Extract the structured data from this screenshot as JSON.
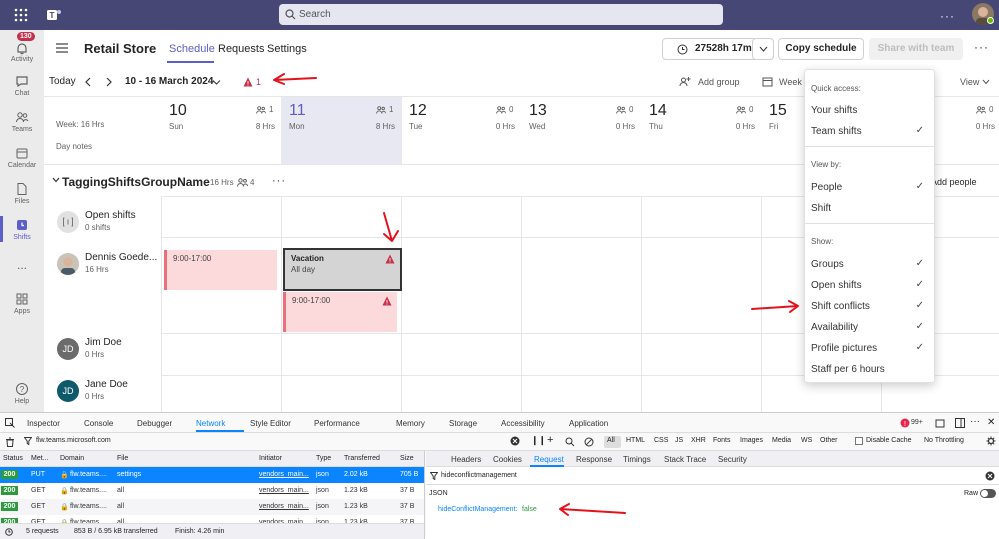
{
  "topbar": {
    "search_placeholder": "Search"
  },
  "rail": {
    "activity_badge": "130",
    "items": [
      {
        "label": "Activity",
        "icon": "bell-icon"
      },
      {
        "label": "Chat",
        "icon": "chat-icon"
      },
      {
        "label": "Teams",
        "icon": "teams-icon"
      },
      {
        "label": "Calendar",
        "icon": "calendar-icon"
      },
      {
        "label": "Files",
        "icon": "files-icon"
      },
      {
        "label": "Shifts",
        "icon": "shifts-icon"
      },
      {
        "label": "...",
        "icon": "more-icon"
      },
      {
        "label": "Apps",
        "icon": "apps-icon"
      },
      {
        "label": "Help",
        "icon": "help-icon"
      }
    ]
  },
  "header": {
    "title": "Retail Store",
    "tabs": [
      "Schedule",
      "Requests",
      "Settings"
    ],
    "timer": "27528h 17m",
    "copy_schedule": "Copy schedule",
    "share": "Share with team"
  },
  "toolbar": {
    "today": "Today",
    "date_range": "10 - 16 March 2024",
    "conflict_count": "1",
    "add_group": "Add group",
    "week": "Week",
    "view": "View"
  },
  "days": [
    {
      "num": "10",
      "name": "Sun",
      "people": "1",
      "hrs": "8 Hrs"
    },
    {
      "num": "11",
      "name": "Mon",
      "people": "1",
      "hrs": "8 Hrs"
    },
    {
      "num": "12",
      "name": "Tue",
      "people": "0",
      "hrs": "0 Hrs"
    },
    {
      "num": "13",
      "name": "Wed",
      "people": "0",
      "hrs": "0 Hrs"
    },
    {
      "num": "14",
      "name": "Thu",
      "people": "0",
      "hrs": "0 Hrs"
    },
    {
      "num": "15",
      "name": "Fri",
      "people": "",
      "hrs": ""
    },
    {
      "num": "",
      "name": "",
      "people": "0",
      "hrs": "0 Hrs"
    }
  ],
  "week_info": "Week: 16 Hrs",
  "day_notes": "Day notes",
  "group": {
    "name": "TaggingShiftsGroupName",
    "hrs": "16 Hrs",
    "people": "4",
    "add_people": "Add people"
  },
  "members": [
    {
      "name": "Open shifts",
      "sub": "0 shifts"
    },
    {
      "name": "Dennis Goede...",
      "sub": "16 Hrs"
    },
    {
      "name": "Jim Doe",
      "sub": "0 Hrs",
      "initials": "JD",
      "color": "#6b6b6b"
    },
    {
      "name": "Jane Doe",
      "sub": "0 Hrs",
      "initials": "JD",
      "color": "#0e5a6b"
    }
  ],
  "shifts": [
    {
      "time": "9:00-17:00"
    },
    {
      "title": "Vacation",
      "sub": "All day"
    },
    {
      "time": "9:00-17:00"
    }
  ],
  "view_menu": {
    "quick_access": "Quick access:",
    "your_shifts": "Your shifts",
    "team_shifts": "Team shifts",
    "view_by": "View by:",
    "people": "People",
    "shift": "Shift",
    "show": "Show:",
    "groups": "Groups",
    "open_shifts": "Open shifts",
    "shift_conflicts": "Shift conflicts",
    "availability": "Availability",
    "profile_pictures": "Profile pictures",
    "staff_per_6": "Staff per 6 hours"
  },
  "devtools": {
    "tabs": [
      "Inspector",
      "Console",
      "Debugger",
      "Network",
      "Style Editor",
      "Performance",
      "Memory",
      "Storage",
      "Accessibility",
      "Application"
    ],
    "error_count": "99+",
    "filter_url": "flw.teams.microsoft.com",
    "type_filters": [
      "All",
      "HTML",
      "CSS",
      "JS",
      "XHR",
      "Fonts",
      "Images",
      "Media",
      "WS",
      "Other"
    ],
    "disable_cache": "Disable Cache",
    "throttling": "No Throttling",
    "columns": [
      "Status",
      "Met...",
      "Domain",
      "File",
      "Initiator",
      "Type",
      "Transferred",
      "Size"
    ],
    "rows": [
      {
        "status": "200",
        "method": "PUT",
        "domain": "flw.teams....",
        "file": "settings",
        "initiator": "vendors_main...",
        "type": "json",
        "transferred": "2.02 kB",
        "size": "705 B"
      },
      {
        "status": "200",
        "method": "GET",
        "domain": "flw.teams....",
        "file": "all",
        "initiator": "vendors_main...",
        "type": "json",
        "transferred": "1.23 kB",
        "size": "37 B"
      },
      {
        "status": "200",
        "method": "GET",
        "domain": "flw.teams....",
        "file": "all",
        "initiator": "vendors_main...",
        "type": "json",
        "transferred": "1.23 kB",
        "size": "37 B"
      },
      {
        "status": "200",
        "method": "GET",
        "domain": "flw.teams....",
        "file": "all",
        "initiator": "vendors_main...",
        "type": "json",
        "transferred": "1.23 kB",
        "size": "37 B"
      }
    ],
    "summary": {
      "requests": "5 requests",
      "transferred": "853 B / 6.95 kB transferred",
      "finish": "Finish: 4.26 min"
    },
    "detail_tabs": [
      "Headers",
      "Cookies",
      "Request",
      "Response",
      "Timings",
      "Stack Trace",
      "Security"
    ],
    "filter_value": "hideconflictmanagement",
    "json_label": "JSON",
    "raw_label": "Raw",
    "json_key": "hideConflictManagement:",
    "json_value": "false"
  }
}
